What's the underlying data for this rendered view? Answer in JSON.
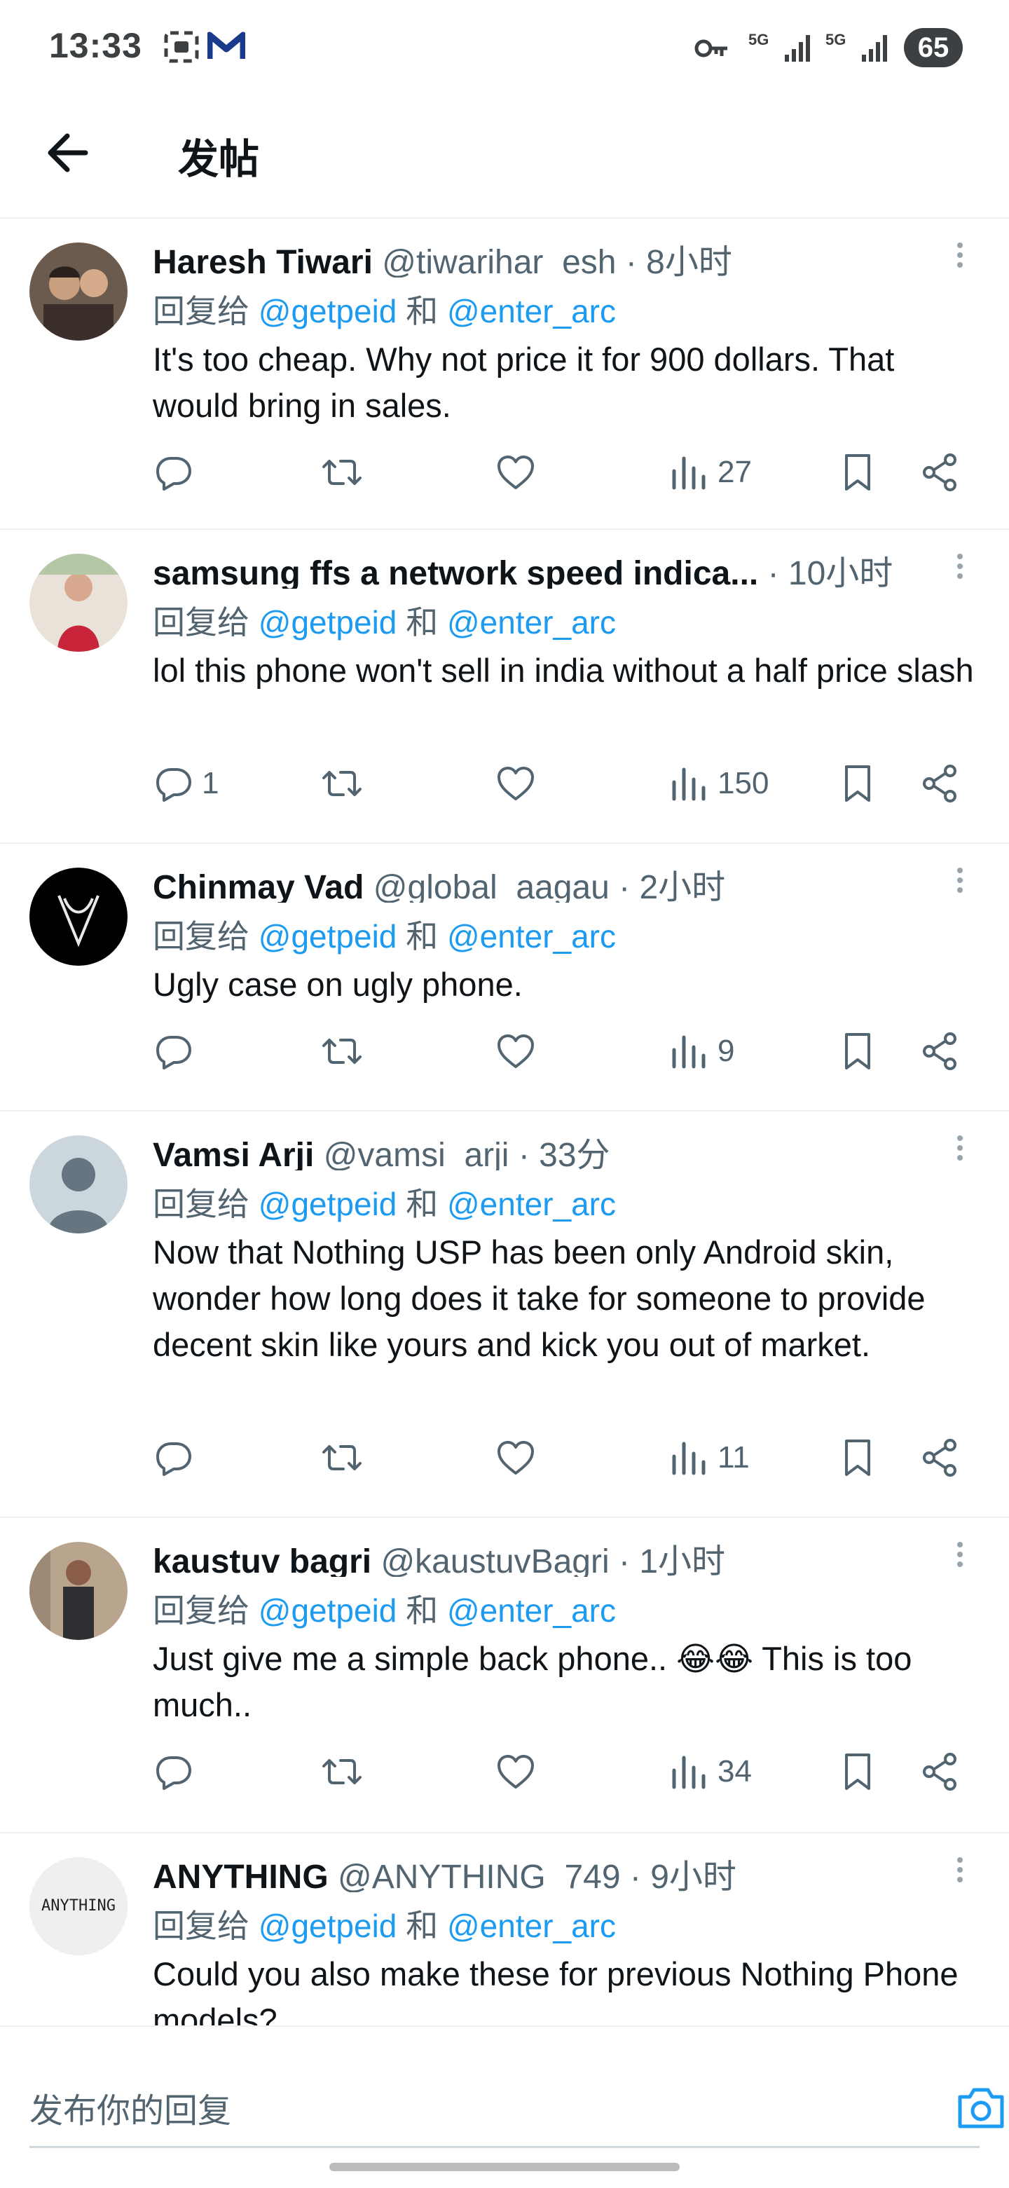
{
  "status_bar": {
    "time": "13:33",
    "network1": "5G",
    "network2": "5G",
    "battery": "65"
  },
  "header": {
    "title": "发帖"
  },
  "reply_prefix": "回复给",
  "reply_and": "和",
  "tweets": [
    {
      "name": "Haresh Tiwari",
      "handle": "@tiwarihar_esh",
      "dot": "·",
      "time": "8小时",
      "mention1": "@getpeid",
      "mention2": "@enter_arc",
      "text": "It's too cheap. Why not price it for 900 dollars. That would bring in sales.",
      "reply_count": "",
      "views": "27"
    },
    {
      "name": "samsung ffs a network speed indica...",
      "handle": "",
      "dot": "·",
      "time": "10小时",
      "mention1": "@getpeid",
      "mention2": "@enter_arc",
      "text": "lol this phone won't sell in india without a half price slash",
      "reply_count": "1",
      "views": "150"
    },
    {
      "name": "Chinmay Vad",
      "handle": "@global_aagau",
      "dot": "·",
      "time": "2小时",
      "mention1": "@getpeid",
      "mention2": "@enter_arc",
      "text": "Ugly case on ugly phone.",
      "reply_count": "",
      "views": "9"
    },
    {
      "name": "Vamsi Arji",
      "handle": "@vamsi_arji",
      "dot": "·",
      "time": "33分",
      "mention1": "@getpeid",
      "mention2": "@enter_arc",
      "text": "Now that Nothing USP has been only Android skin, wonder how long does it take for someone to provide decent skin like yours and kick you out of market.",
      "reply_count": "",
      "views": "11"
    },
    {
      "name": "kaustuv bagri",
      "handle": "@kaustuvBagri",
      "dot": "·",
      "time": "1小时",
      "mention1": "@getpeid",
      "mention2": "@enter_arc",
      "text": "Just give me a simple back phone.. 😂😂 This is too much..",
      "reply_count": "",
      "views": "34"
    },
    {
      "name": "ANYTHING",
      "handle": "@ANYTHING_749",
      "dot": "·",
      "time": "9小时",
      "mention1": "@getpeid",
      "mention2": "@enter_arc",
      "text": "Could you also make these for previous Nothing Phone models?",
      "reply_count": "",
      "views": "",
      "avatar_text": "ANYTHING"
    }
  ],
  "composer": {
    "placeholder": "发布你的回复"
  },
  "icons": {
    "back": "arrow-left-icon",
    "reply": "reply-icon",
    "retweet": "retweet-icon",
    "like": "heart-icon",
    "views": "views-icon",
    "bookmark": "bookmark-icon",
    "share": "share-icon",
    "camera": "camera-icon"
  },
  "colors": {
    "accent": "#1d9bf0",
    "secondary_text": "#536471",
    "divider": "#eff3f4"
  }
}
